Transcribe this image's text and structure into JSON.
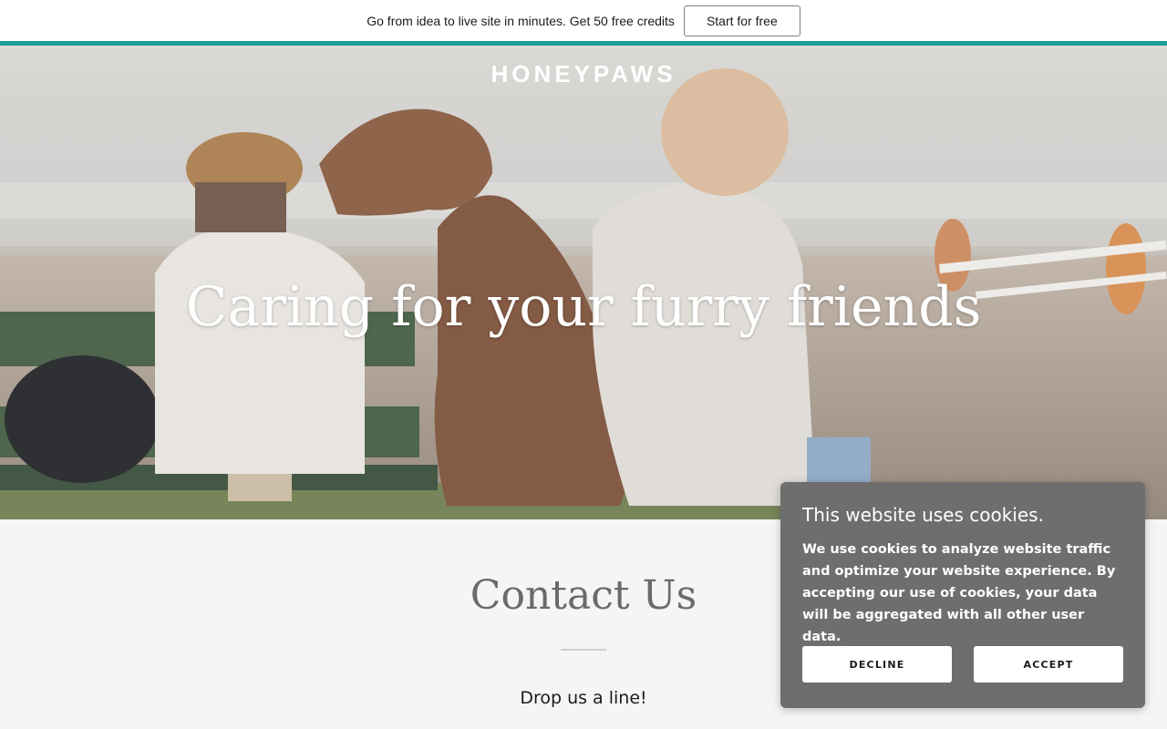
{
  "promo": {
    "text": "Go from idea to live site in minutes. Get 50 free credits",
    "button_label": "Start for free",
    "accent_color": "#1a9e9a"
  },
  "header": {
    "brand": "HONEYPAWS"
  },
  "hero": {
    "title": "Caring for your furry friends"
  },
  "contact": {
    "title": "Contact Us",
    "subtitle": "Drop us a line!"
  },
  "cookie_banner": {
    "title": "This website uses cookies.",
    "body": "We use cookies to analyze website traffic and optimize your website experience. By accepting our use of cookies, your data will be aggregated with all other user data.",
    "decline_label": "DECLINE",
    "accept_label": "ACCEPT"
  }
}
